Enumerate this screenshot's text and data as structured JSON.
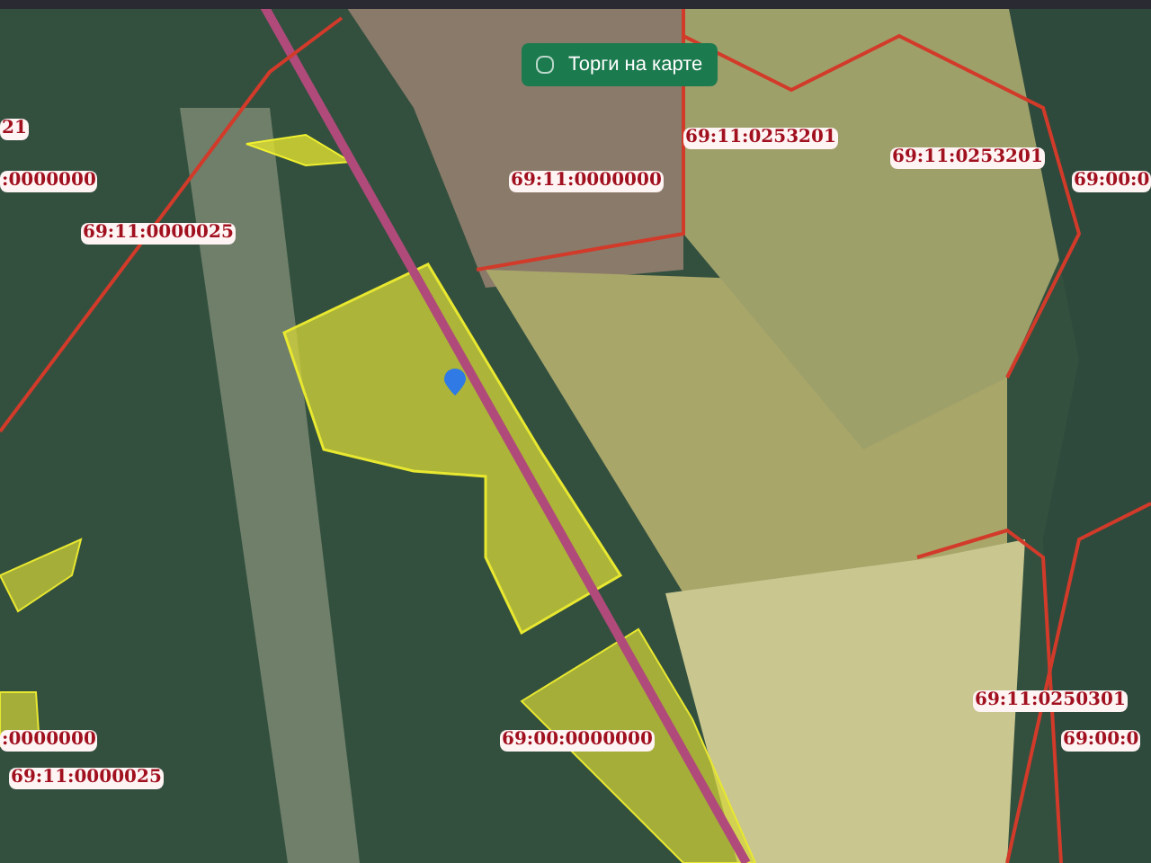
{
  "toggle": {
    "label": "Торги на карте",
    "checked": false
  },
  "labels": [
    {
      "text": "21"
    },
    {
      "text": "69:11:0253201"
    },
    {
      "text": "69:11:0253201"
    },
    {
      "text": ":0000000"
    },
    {
      "text": "69:11:0000000"
    },
    {
      "text": "69:00:0"
    },
    {
      "text": "69:11:0000025"
    },
    {
      "text": "69:11:0250301"
    },
    {
      "text": ":0000000"
    },
    {
      "text": "69:00:0000000"
    },
    {
      "text": "69:00:0"
    },
    {
      "text": "69:11:0000025"
    }
  ]
}
